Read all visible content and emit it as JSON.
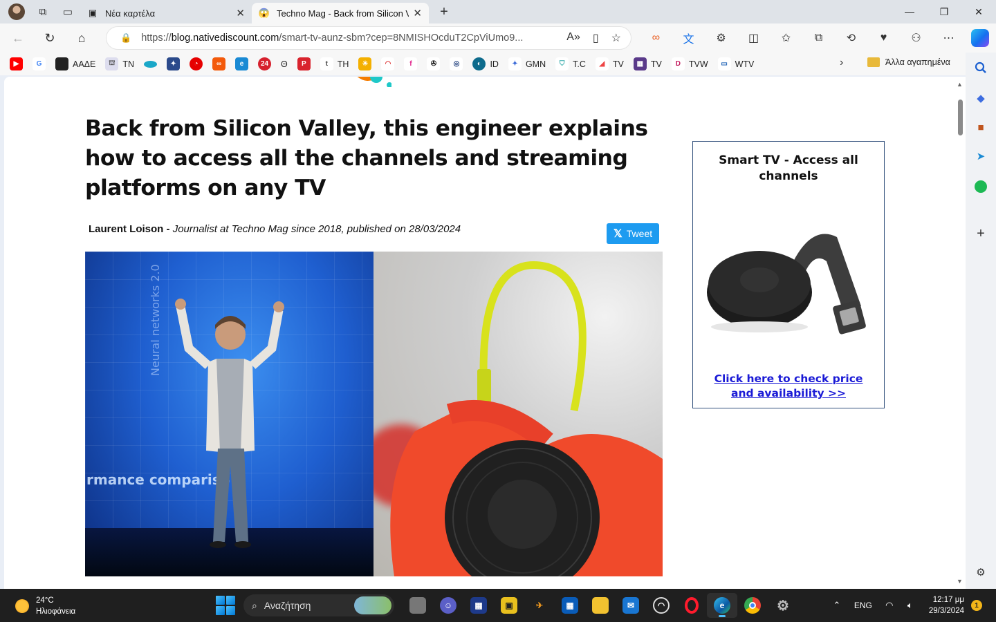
{
  "browser": {
    "tabs": [
      {
        "title": "Νέα καρτέλα",
        "icon": "new-tab-icon",
        "active": false
      },
      {
        "title": "Techno Mag - Back from Silicon V",
        "icon": "techno-mag-favicon",
        "active": true
      }
    ],
    "url_prefix": "https://",
    "url_domain": "blog.nativediscount.com",
    "url_path": "/smart-tv-aunz-sbm?cep=8NMISHOcduT2CpViUmo9...",
    "favorites": [
      "",
      "",
      "ΑΑΔΕ",
      "TN",
      "",
      "",
      "",
      "",
      "",
      "",
      "Θ",
      "",
      "TH",
      "",
      "",
      "",
      "",
      "",
      "ID",
      "GMN",
      "T.C",
      "TV",
      "TV",
      "TVW",
      "WTV"
    ],
    "other_favorites": "Άλλα αγαπημένα"
  },
  "article": {
    "headline": "Back from Silicon Valley, this engineer explains how to access all the channels and streaming platforms on any TV",
    "author": "Laurent Loison",
    "separator": "-",
    "meta": "Journalist at Techno Mag since 2018, published on 28/03/2024",
    "tweet_label": "Tweet",
    "image_screen_text": "rmance compariso",
    "image_vertical_text": "Neural networks 2.0"
  },
  "ad": {
    "title": "Smart TV - Access all channels",
    "link": "Click here to check price and availability >>"
  },
  "taskbar": {
    "weather_temp": "24°C",
    "weather_desc": "Ηλιοφάνεια",
    "search_placeholder": "Αναζήτηση",
    "language": "ENG",
    "time": "12:17 μμ",
    "date": "29/3/2024",
    "notification_count": "1"
  },
  "colors": {
    "accent": "#1d9bf0",
    "ad_link": "#1a1ad6",
    "ad_border": "#2f4d7a"
  }
}
